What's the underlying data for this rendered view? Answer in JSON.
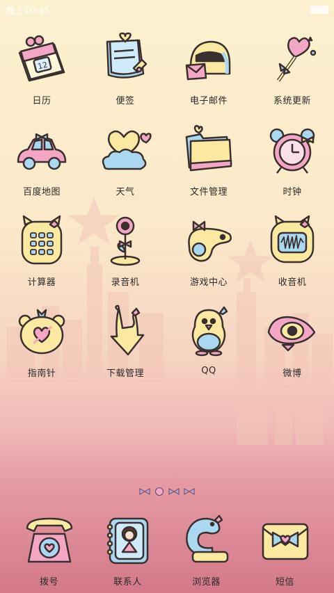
{
  "status_bar": {
    "time": "晚上10:45"
  },
  "apps": [
    {
      "label": "日历",
      "name": "app-calendar",
      "icon": "calendar-icon"
    },
    {
      "label": "便签",
      "name": "app-notes",
      "icon": "notes-icon"
    },
    {
      "label": "电子邮件",
      "name": "app-email",
      "icon": "email-icon"
    },
    {
      "label": "系统更新",
      "name": "app-system-update",
      "icon": "lollipop-icon"
    },
    {
      "label": "百度地图",
      "name": "app-baidu-map",
      "icon": "car-icon"
    },
    {
      "label": "天气",
      "name": "app-weather",
      "icon": "cloud-heart-icon"
    },
    {
      "label": "文件管理",
      "name": "app-file-manager",
      "icon": "folder-icon"
    },
    {
      "label": "时钟",
      "name": "app-clock",
      "icon": "alarm-clock-icon"
    },
    {
      "label": "计算器",
      "name": "app-calculator",
      "icon": "calculator-icon"
    },
    {
      "label": "录音机",
      "name": "app-recorder",
      "icon": "flower-mic-icon"
    },
    {
      "label": "游戏中心",
      "name": "app-game-center",
      "icon": "gamepad-icon"
    },
    {
      "label": "收音机",
      "name": "app-radio",
      "icon": "radio-icon"
    },
    {
      "label": "指南针",
      "name": "app-compass",
      "icon": "compass-icon"
    },
    {
      "label": "下载管理",
      "name": "app-download-manager",
      "icon": "download-arrow-icon"
    },
    {
      "label": "QQ",
      "name": "app-qq",
      "icon": "penguin-icon"
    },
    {
      "label": "微博",
      "name": "app-weibo",
      "icon": "eye-icon"
    }
  ],
  "dock": [
    {
      "label": "拨号",
      "name": "dock-phone",
      "icon": "phone-icon"
    },
    {
      "label": "联系人",
      "name": "dock-contacts",
      "icon": "contacts-book-icon"
    },
    {
      "label": "浏览器",
      "name": "dock-browser",
      "icon": "browser-icon"
    },
    {
      "label": "短信",
      "name": "dock-messages",
      "icon": "envelope-icon"
    }
  ],
  "colors": {
    "pink": "#f4a7c4",
    "blue": "#a9d8f0",
    "yellow": "#fbe8a1",
    "outline": "#3a2f2f"
  }
}
